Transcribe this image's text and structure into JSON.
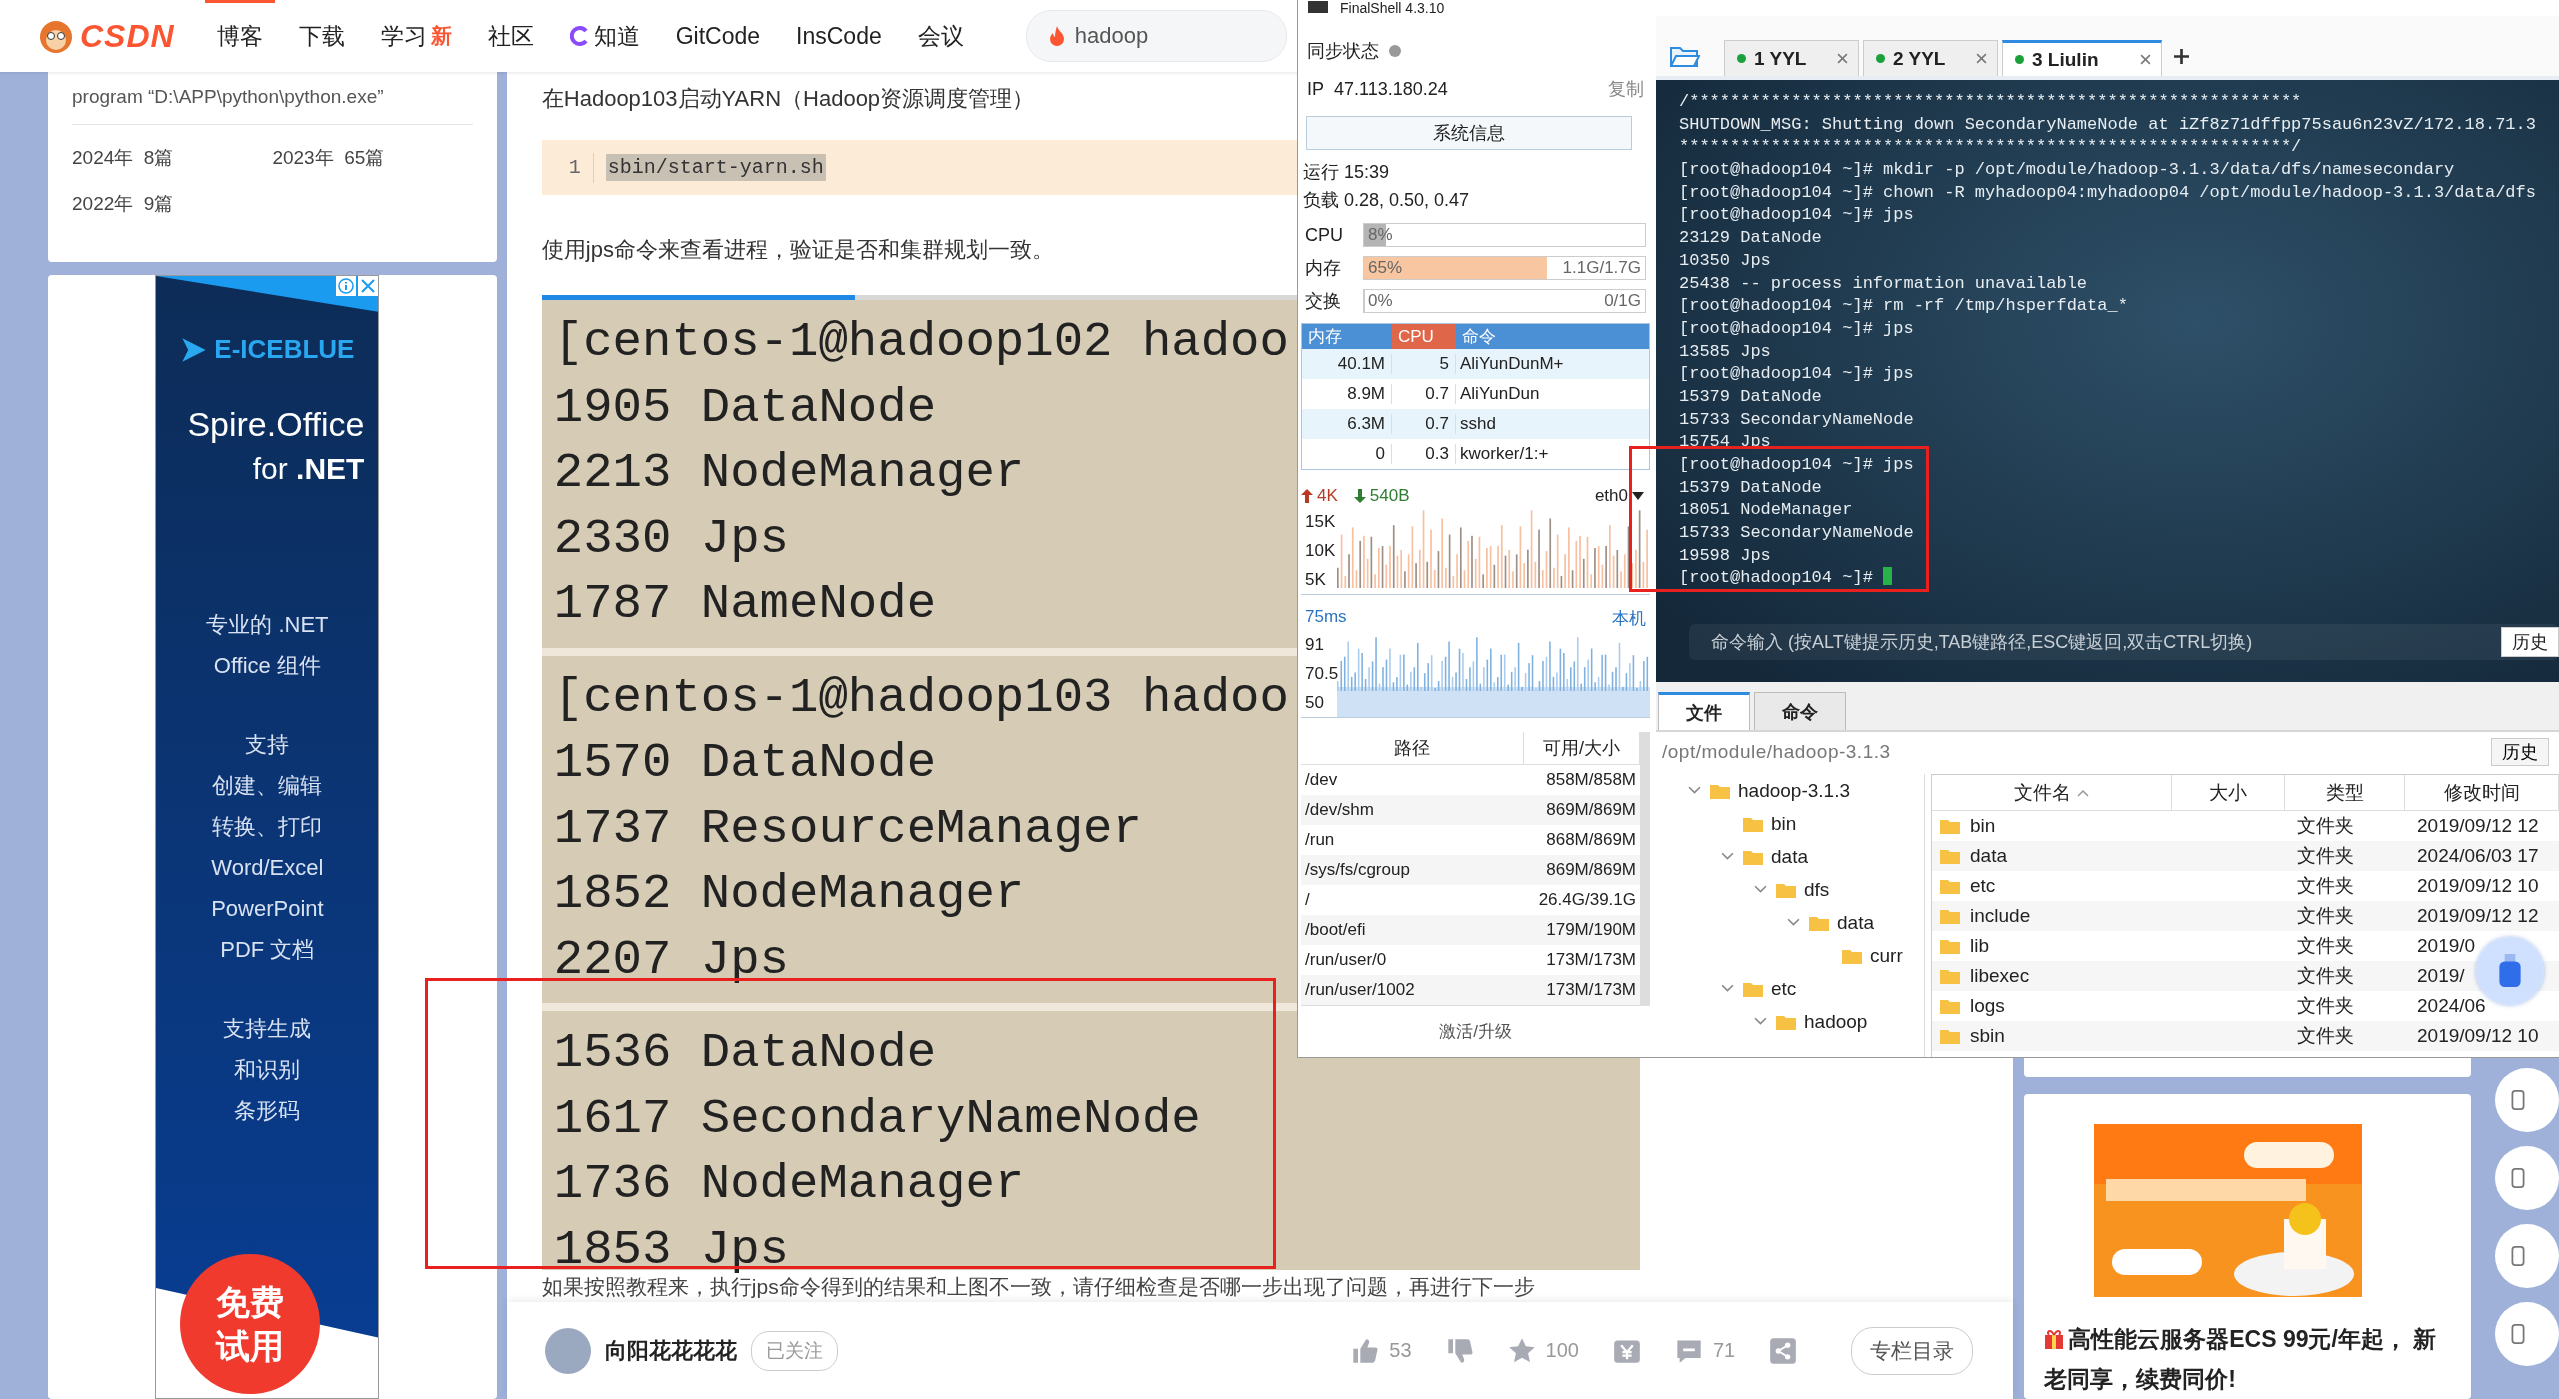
{
  "page": {
    "header": {
      "logo": "CSDN",
      "nav": [
        {
          "label": "博客",
          "kind": "text",
          "selected": true
        },
        {
          "label": "下载",
          "kind": "text",
          "selected": false
        },
        {
          "label": "学习",
          "kind": "badge",
          "badge": "新",
          "selected": false
        },
        {
          "label": "社区",
          "kind": "text",
          "selected": false
        },
        {
          "label": "知道",
          "kind": "icon",
          "selected": false
        },
        {
          "label": "GitCode",
          "kind": "text",
          "selected": false
        },
        {
          "label": "InsCode",
          "kind": "text",
          "selected": false
        },
        {
          "label": "会议",
          "kind": "text",
          "selected": false
        }
      ],
      "search": {
        "value": "hadoop"
      }
    },
    "sidebar": {
      "note": "program “D:\\APP\\python\\python.exe”",
      "archive": [
        {
          "year": "2024年",
          "count": "8篇"
        },
        {
          "year": "2023年",
          "count": "65篇"
        },
        {
          "year": "2022年",
          "count": "9篇"
        }
      ]
    },
    "side_ad": {
      "brand": "E-ICEBLUE",
      "title": "Spire.Office",
      "subtitle": "for **.NET**",
      "paragraphs": [
        [
          "专业的 .NET",
          "Office 组件"
        ],
        [
          "支持",
          "创建、编辑",
          "转换、打印",
          "Word/Excel",
          "PowerPoint",
          "PDF 文档"
        ],
        [
          "支持生成",
          "和识别",
          "条形码"
        ]
      ],
      "cta": [
        "免费",
        "试用"
      ]
    },
    "article": {
      "heading": "在Hadoop103启动YARN（Hadoop资源调度管理）",
      "code": {
        "line_number": "1",
        "text": "sbin/start-yarn.sh"
      },
      "paragraph": "使用jps命令来查看进程，验证是否和集群规划一致。",
      "progress": {
        "level": 0.285
      },
      "screenshot": [
        {
          "lines": [
            "[centos-1@hadoop102 hadoo",
            "1905 DataNode",
            "2213 NodeManager",
            "2330 Jps",
            "1787 NameNode"
          ]
        },
        {
          "lines": [
            "[centos-1@hadoop103 hadoo",
            "1570 DataNode",
            "1737 ResourceManager",
            "1852 NodeManager",
            "2207 Jps"
          ]
        },
        {
          "lines": [
            "1536 DataNode",
            "1617 SecondaryNameNode",
            "1736 NodeManager",
            "1853 Jps"
          ]
        }
      ],
      "note": "如果按照教程来，执行jps命令得到的结果和上图不一致，请仔细检查是否哪一步出现了问题，再进行下一步"
    },
    "bottom_bar": {
      "author": "向阳花花花花",
      "follow": "已关注",
      "actions": [
        {
          "kind": "like",
          "count": "53"
        },
        {
          "kind": "dislike"
        },
        {
          "kind": "star",
          "count": "100"
        },
        {
          "kind": "reward"
        },
        {
          "kind": "comment",
          "count": "71"
        },
        {
          "kind": "share"
        }
      ],
      "catalog": "专栏目录"
    },
    "right_ad": {
      "kind": "picture",
      "caption": "高性能云服务器ECS 99元/年起， 新老同享，续费同价!"
    }
  },
  "finalshell": {
    "title": "FinalShell 4.3.10",
    "sync_label": "同步状态",
    "ip_label": "IP",
    "ip": "47.113.180.24",
    "copy": "复制",
    "sysinfo": "系统信息",
    "uptime": "运行 15:39",
    "load": "负载 0.28, 0.50, 0.47",
    "meters": [
      {
        "label": "CPU",
        "reading": "8%",
        "level": 0.08,
        "color": "#b5b5b5"
      },
      {
        "label": "内存",
        "reading": "65%",
        "detail": "1.1G/1.7G",
        "level": 0.65,
        "color": "#f8c6a0"
      },
      {
        "label": "交换",
        "reading": "0%",
        "detail": "0/1G",
        "level": 0
      }
    ],
    "processes": {
      "columns": [
        {
          "label": "内存",
          "selected": false
        },
        {
          "label": "CPU",
          "selected": true
        },
        {
          "label": "命令",
          "selected": false
        }
      ],
      "rows": [
        [
          "40.1M",
          "5",
          "AliYunDunM+"
        ],
        [
          "8.9M",
          "0.7",
          "AliYunDun"
        ],
        [
          "6.3M",
          "0.7",
          "sshd"
        ],
        [
          "0",
          "0.3",
          "kworker/1:+"
        ]
      ]
    },
    "network": {
      "up": "4K",
      "down": "540B",
      "interface": "eth0",
      "yticks": [
        "15K",
        "10K",
        "5K"
      ]
    },
    "ping": {
      "latency": "75ms",
      "host": "本机",
      "yticks": [
        "91",
        "70.5",
        "50"
      ]
    },
    "disks": {
      "columns": [
        "路径",
        "可用/大小"
      ],
      "rows": [
        [
          "/dev",
          "858M/858M"
        ],
        [
          "/dev/shm",
          "869M/869M"
        ],
        [
          "/run",
          "868M/869M"
        ],
        [
          "/sys/fs/cgroup",
          "869M/869M"
        ],
        [
          "/",
          "26.4G/39.1G"
        ],
        [
          "/boot/efi",
          "179M/190M"
        ],
        [
          "/run/user/0",
          "173M/173M"
        ],
        [
          "/run/user/1002",
          "173M/173M"
        ]
      ]
    },
    "activate": "激活/升级",
    "tabs": [
      {
        "index": "1",
        "label": "YYL",
        "selected": false
      },
      {
        "index": "2",
        "label": "YYL",
        "selected": false
      },
      {
        "index": "3",
        "label": "Liulin",
        "selected": true
      }
    ],
    "terminal": {
      "lines": [
        "/************************************************************",
        "SHUTDOWN_MSG: Shutting down SecondaryNameNode at iZf8z71dffpp75sau6n23vZ/172.18.71.3",
        "************************************************************/",
        "[root@hadoop104 ~]# mkdir -p /opt/module/hadoop-3.1.3/data/dfs/namesecondary",
        "[root@hadoop104 ~]# chown -R myhadoop04:myhadoop04 /opt/module/hadoop-3.1.3/data/dfs",
        "[root@hadoop104 ~]# jps",
        "23129 DataNode",
        "10350 Jps",
        "25438 -- process information unavailable",
        "[root@hadoop104 ~]# rm -rf /tmp/hsperfdata_*",
        "[root@hadoop104 ~]# jps",
        "13585 Jps",
        "[root@hadoop104 ~]# jps",
        "15379 DataNode",
        "15733 SecondaryNameNode",
        "15754 Jps",
        "[root@hadoop104 ~]# jps",
        "15379 DataNode",
        "18051 NodeManager",
        "15733 SecondaryNameNode",
        "19598 Jps",
        "[root@hadoop104 ~]#"
      ],
      "cursor": true
    },
    "command_input": {
      "placeholder": "命令输入 (按ALT键提示历史,TAB键路径,ESC键返回,双击CTRL切换)",
      "history": "历史"
    },
    "file_panel": {
      "tabs": [
        {
          "label": "文件",
          "selected": true
        },
        {
          "label": "命令",
          "selected": false
        }
      ],
      "path": "/opt/module/hadoop-3.1.3",
      "history": "历史",
      "tree": [
        {
          "name": "hadoop-3.1.3",
          "expanded": true,
          "children": [
            {
              "name": "bin"
            },
            {
              "name": "data",
              "expanded": true,
              "children": [
                {
                  "name": "dfs",
                  "expanded": true,
                  "children": [
                    {
                      "name": "data",
                      "expanded": true,
                      "children": [
                        {
                          "name": "curr"
                        }
                      ]
                    }
                  ]
                }
              ]
            },
            {
              "name": "etc",
              "expanded": true,
              "children": [
                {
                  "name": "hadoop",
                  "expanded": true
                }
              ]
            }
          ]
        }
      ],
      "columns": [
        {
          "label": "文件名",
          "sorted": true
        },
        {
          "label": "大小",
          "sorted": false
        },
        {
          "label": "类型",
          "sorted": false
        },
        {
          "label": "修改时间",
          "sorted": false
        }
      ],
      "files": [
        {
          "name": "bin",
          "type": "文件夹",
          "modified": "2019/09/12 12"
        },
        {
          "name": "data",
          "type": "文件夹",
          "modified": "2024/06/03 17"
        },
        {
          "name": "etc",
          "type": "文件夹",
          "modified": "2019/09/12 10"
        },
        {
          "name": "include",
          "type": "文件夹",
          "modified": "2019/09/12 12"
        },
        {
          "name": "lib",
          "type": "文件夹",
          "modified": "2019/0"
        },
        {
          "name": "libexec",
          "type": "文件夹",
          "modified": "2019/"
        },
        {
          "name": "logs",
          "type": "文件夹",
          "modified": "2024/06"
        },
        {
          "name": "sbin",
          "type": "文件夹",
          "modified": "2019/09/12 10"
        }
      ]
    }
  }
}
